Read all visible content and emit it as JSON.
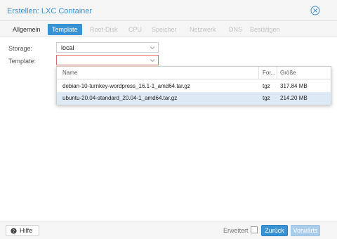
{
  "dialog": {
    "title": "Erstellen: LXC Container"
  },
  "tabs": [
    {
      "label": "Allgemein",
      "state": "enabled"
    },
    {
      "label": "Template",
      "state": "active"
    },
    {
      "label": "Root-Disk",
      "state": "disabled"
    },
    {
      "label": "CPU",
      "state": "disabled"
    },
    {
      "label": "Speicher",
      "state": "disabled"
    },
    {
      "label": "Netzwerk",
      "state": "disabled"
    },
    {
      "label": "DNS",
      "state": "disabled"
    },
    {
      "label": "Bestätigen",
      "state": "disabled"
    }
  ],
  "form": {
    "storage_label": "Storage:",
    "storage_value": "local",
    "template_label": "Template:",
    "template_value": ""
  },
  "picker": {
    "columns": [
      "Name",
      "For...",
      "Größe"
    ],
    "rows": [
      {
        "name": "debian-10-turnkey-wordpress_16.1-1_amd64.tar.gz",
        "format": "tgz",
        "size": "317.84 MB",
        "selected": false
      },
      {
        "name": "ubuntu-20.04-standard_20.04-1_amd64.tar.gz",
        "format": "tgz",
        "size": "214.20 MB",
        "selected": true
      }
    ]
  },
  "footer": {
    "help_label": "Hilfe",
    "advanced_label": "Erweitert",
    "advanced_checked": false,
    "back_label": "Zurück",
    "next_label": "Vorwärts"
  },
  "colors": {
    "accent": "#3892d4",
    "invalid_border": "#e06b6b",
    "selected_row": "#dde9f5"
  }
}
